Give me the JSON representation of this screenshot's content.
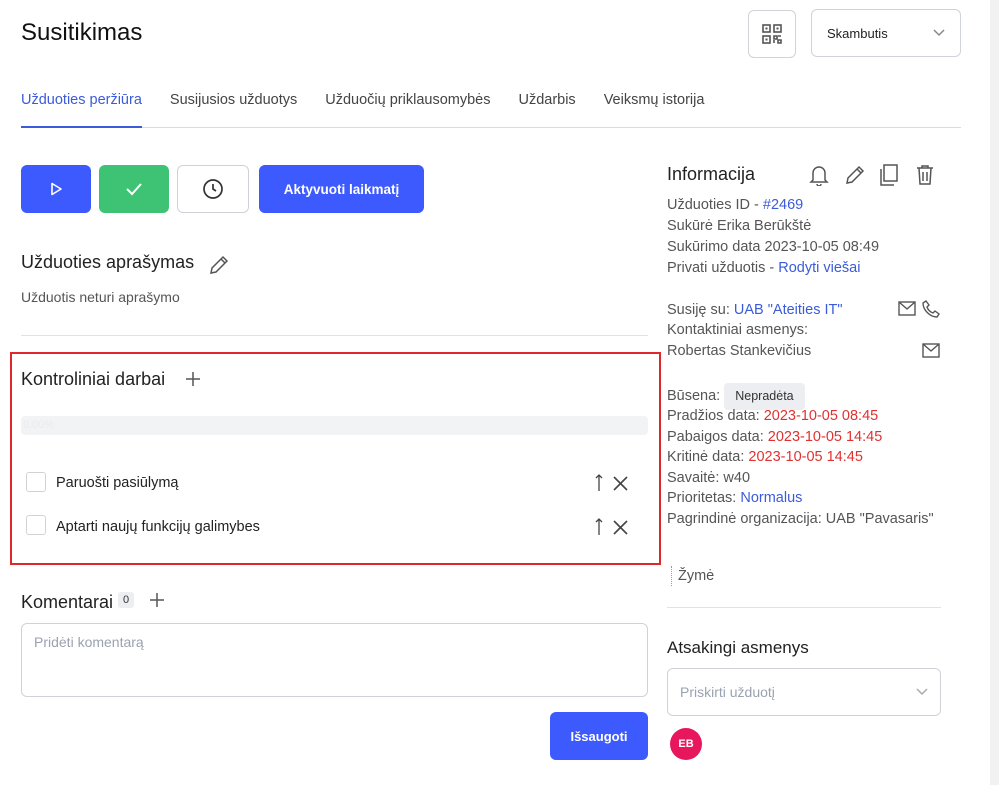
{
  "page": {
    "title": "Susitikimas",
    "type_select_value": "Skambutis"
  },
  "tabs": [
    {
      "label": "Užduoties peržiūra",
      "active": true
    },
    {
      "label": "Susijusios užduotys"
    },
    {
      "label": "Užduočių priklausomybės"
    },
    {
      "label": "Uždarbis"
    },
    {
      "label": "Veiksmų istorija"
    }
  ],
  "actions": {
    "timer_label": "Aktyvuoti laikmatį"
  },
  "description": {
    "heading": "Užduoties aprašymas",
    "text": "Užduotis neturi aprašymo"
  },
  "checklist": {
    "heading": "Kontroliniai darbai",
    "progress_text": "0.00%",
    "progress_value": 0,
    "items": [
      {
        "label": "Paruošti pasiūlymą",
        "checked": false
      },
      {
        "label": "Aptarti naujų funkcijų galimybes",
        "checked": false
      }
    ]
  },
  "comments": {
    "heading": "Komentarai",
    "count": "0",
    "placeholder": "Pridėti komentarą",
    "save_label": "Išsaugoti"
  },
  "info": {
    "heading": "Informacija",
    "task_id_label": "Užduoties ID - ",
    "task_id": "#2469",
    "created_by": "Sukūrė Erika Berūkštė",
    "created_date": "Sukūrimo data 2023-10-05 08:49",
    "private_label": "Privati užduotis - ",
    "private_link": "Rodyti viešai",
    "related_label": "Susiję su: ",
    "related_link": "UAB \"Ateities IT\"",
    "contacts_label": "Kontaktiniai asmenys:",
    "contact_name": "Robertas Stankevičius",
    "status_label": "Būsena: ",
    "status": "Nepradėta",
    "start_label": "Pradžios data: ",
    "start_date": "2023-10-05 08:45",
    "end_label": "Pabaigos data: ",
    "end_date": "2023-10-05 14:45",
    "critical_label": "Kritinė data: ",
    "critical_date": "2023-10-05 14:45",
    "week": "Savaitė: w40",
    "priority_label": "Prioritetas: ",
    "priority": "Normalus",
    "org": "Pagrindinė organizacija: UAB \"Pavasaris\"",
    "tag_label": "Žymė"
  },
  "assignees": {
    "heading": "Atsakingi asmenys",
    "placeholder": "Priskirti užduotį",
    "avatar_initials": "EB",
    "avatar_color": "#e8175d"
  },
  "colors": {
    "primary": "#3d5afe",
    "success": "#3dc373",
    "danger": "#e03131",
    "highlight_border": "#e0282c"
  }
}
